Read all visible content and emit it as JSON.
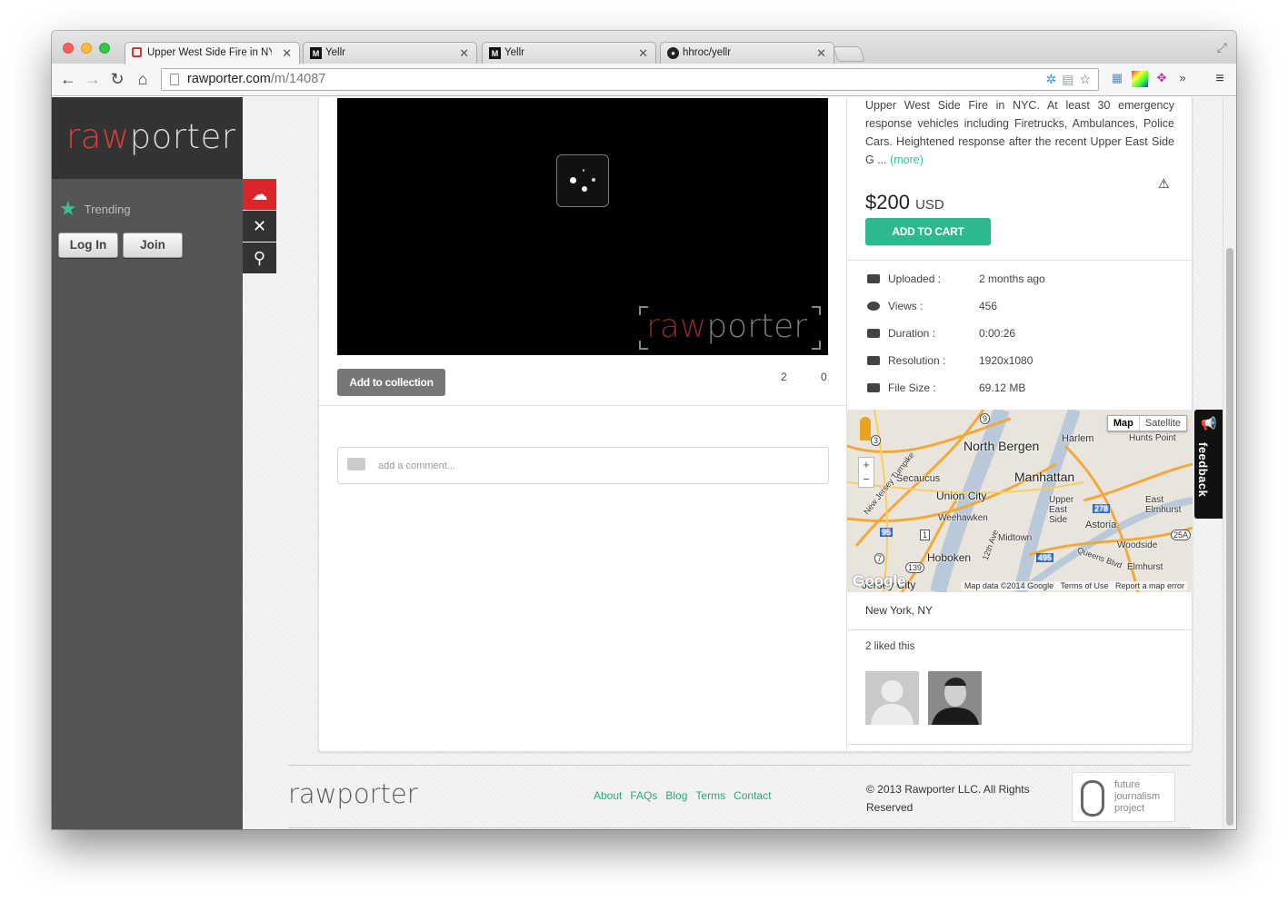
{
  "browser": {
    "tabs": [
      {
        "title": "Upper West Side Fire in NY",
        "icon": "rawporter-favicon",
        "active": true
      },
      {
        "title": "Yellr",
        "icon": "yellr-favicon",
        "active": false
      },
      {
        "title": "Yellr",
        "icon": "yellr-favicon",
        "active": false
      },
      {
        "title": "hhroc/yellr",
        "icon": "github-favicon",
        "active": false
      }
    ],
    "url_host": "rawporter.com",
    "url_path": "/m/14087"
  },
  "sidebar": {
    "logo_raw": "raw",
    "logo_porter": "porter",
    "trending_label": "Trending",
    "login_label": "Log In",
    "join_label": "Join"
  },
  "media": {
    "watermark_raw": "raw",
    "watermark_porter": "porter",
    "add_collection_label": "Add to collection",
    "count_a": "2",
    "count_b": "0",
    "comment_placeholder": "add a comment..."
  },
  "details": {
    "description": "Upper West Side Fire in NYC. At least 30 emergency response vehicles including Firetrucks, Ambulances, Police Cars. Heightened response after the recent Upper East Side G ...",
    "more_label": "(more)",
    "price": "$200",
    "currency": "USD",
    "cart_label": "ADD TO CART",
    "meta": [
      {
        "label": "Uploaded :",
        "value": "2 months ago"
      },
      {
        "label": "Views :",
        "value": "456"
      },
      {
        "label": "Duration :",
        "value": "0:00:26"
      },
      {
        "label": "Resolution :",
        "value": "1920x1080"
      },
      {
        "label": "File Size :",
        "value": "69.12 MB"
      }
    ],
    "map": {
      "type_map": "Map",
      "type_satellite": "Satellite",
      "attribution": "Map data ©2014 Google",
      "terms": "Terms of Use",
      "report": "Report a map error",
      "google": "Google",
      "labels": {
        "north_bergen": "North Bergen",
        "harlem": "Harlem",
        "hunts_point": "Hunts Point",
        "secaucus": "Secaucus",
        "manhattan": "Manhattan",
        "union_city": "Union City",
        "upper_east_side": "Upper East Side",
        "east_elmhurst": "East Elmhurst",
        "weehawken": "Weehawken",
        "astoria": "Astoria",
        "midtown": "Midtown",
        "woodside": "Woodside",
        "hoboken": "Hoboken",
        "queens_blvd": "Queens Blvd",
        "elmhurst": "Elmhurst",
        "jersey_city": "Jersey City",
        "nj_turnpike": "New Jersey Turnpike",
        "ave_12th": "12th Ave",
        "rt9": "9",
        "rt3": "3",
        "rt95": "95",
        "rt1": "1",
        "rt7": "7",
        "rt139": "139",
        "rt278": "278",
        "rt25a": "25A",
        "rt495": "495"
      }
    },
    "location": "New York, NY",
    "liked_text": "2 liked this"
  },
  "footer": {
    "logo_text": "rawporter",
    "links": [
      "About",
      "FAQs",
      "Blog",
      "Terms",
      "Contact"
    ],
    "copyright": "© 2013 Rawporter LLC. All Rights Reserved",
    "fjp_text": "future journalism project"
  },
  "feedback_label": "feedback",
  "colors": {
    "accent": "#2db890",
    "brand_red": "#e33b3b",
    "sidebar": "#555555"
  }
}
